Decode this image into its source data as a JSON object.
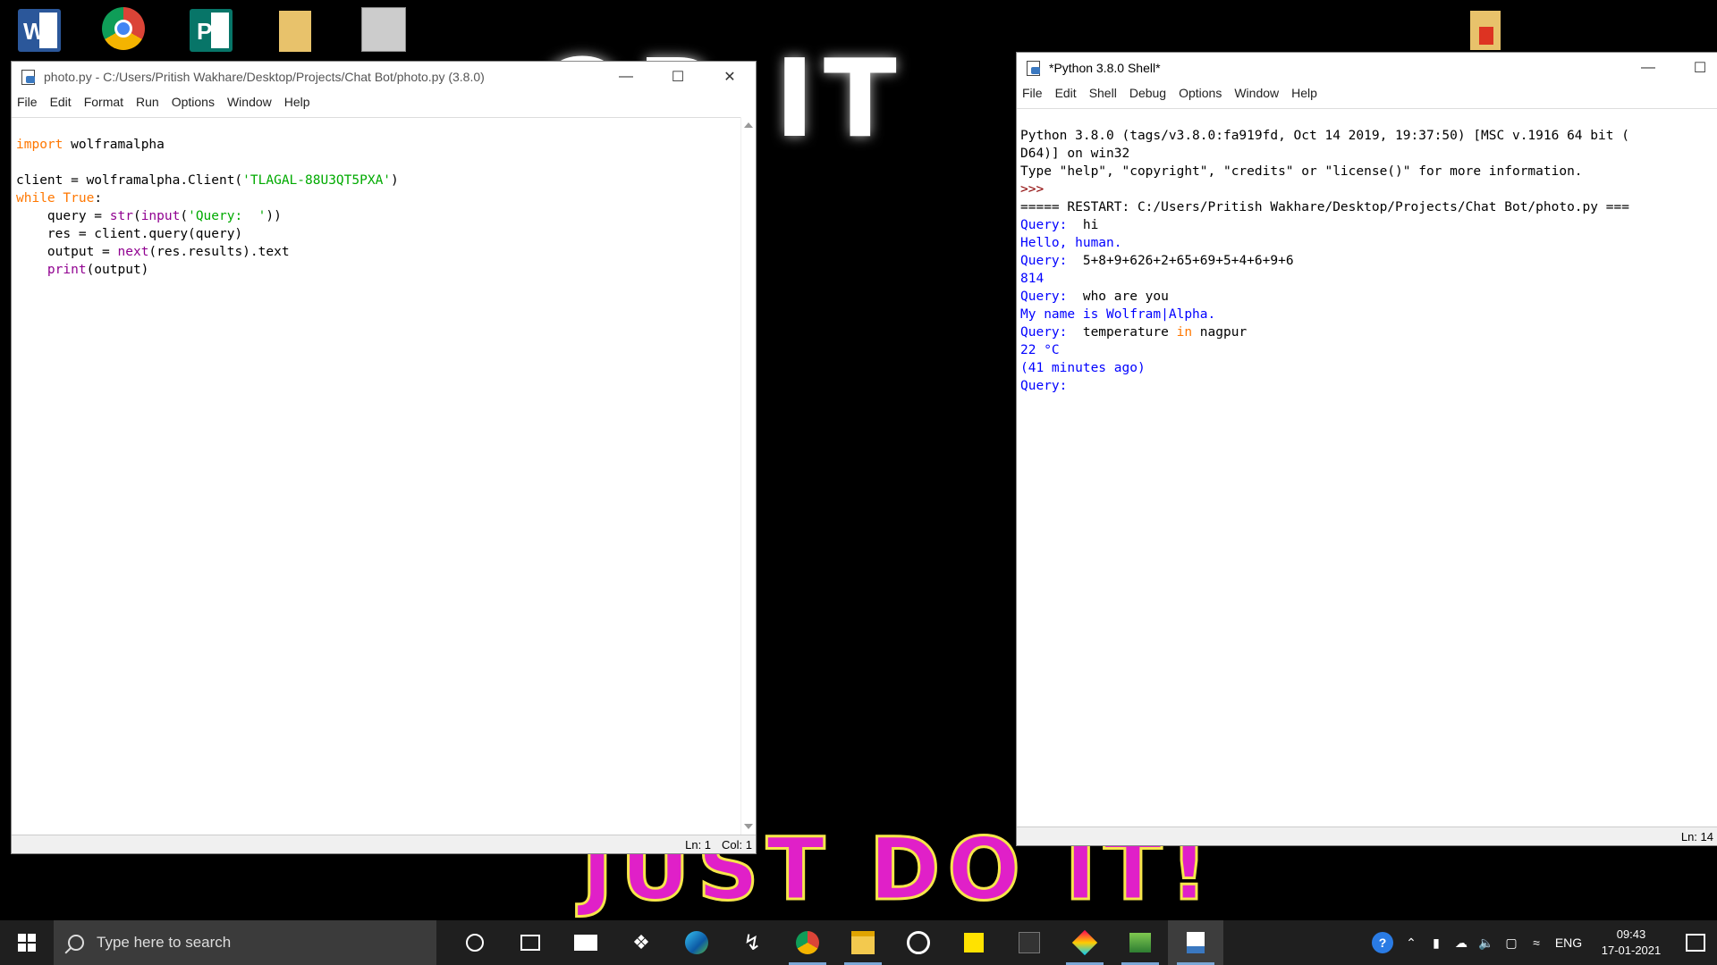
{
  "wallpaper": {
    "top_text": "OR IT",
    "bottom_text": "JUST DO IT!"
  },
  "desktop_icons": [
    "word-icon",
    "chrome-icon",
    "publisher-icon",
    "folder-icon",
    "image-file-icon",
    "pdf-folder-icon"
  ],
  "editor_window": {
    "title": "photo.py - C:/Users/Pritish Wakhare/Desktop/Projects/Chat Bot/photo.py (3.8.0)",
    "menu": [
      "File",
      "Edit",
      "Format",
      "Run",
      "Options",
      "Window",
      "Help"
    ],
    "code": {
      "l1_kw": "import",
      "l1_rest": " wolframalpha",
      "l3_a": "client = wolframalpha.Client(",
      "l3_str": "'TLAGAL-88U3QT5PXA'",
      "l3_b": ")",
      "l4_kw": "while",
      "l4_sp": " ",
      "l4_kw2": "True",
      "l4_b": ":",
      "l5_a": "    query = ",
      "l5_bi1": "str",
      "l5_p": "(",
      "l5_bi2": "input",
      "l5_p2": "(",
      "l5_str": "'Query:  '",
      "l5_b": "))",
      "l6": "    res = client.query(query)",
      "l7_a": "    output = ",
      "l7_bi": "next",
      "l7_b": "(res.results).text",
      "l8_a": "    ",
      "l8_bi": "print",
      "l8_b": "(output)"
    },
    "status": {
      "ln": "Ln: 1",
      "col": "Col: 1"
    }
  },
  "shell_window": {
    "title": "*Python 3.8.0 Shell*",
    "menu": [
      "File",
      "Edit",
      "Shell",
      "Debug",
      "Options",
      "Window",
      "Help"
    ],
    "lines": {
      "banner1": "Python 3.8.0 (tags/v3.8.0:fa919fd, Oct 14 2019, 19:37:50) [MSC v.1916 64 bit (",
      "banner2": "D64)] on win32",
      "banner3": "Type \"help\", \"copyright\", \"credits\" or \"license()\" for more information.",
      "prompt": ">>> ",
      "restart": "===== RESTART: C:/Users/Pritish Wakhare/Desktop/Projects/Chat Bot/photo.py ===",
      "q_label": "Query:  ",
      "q1": "hi",
      "a1": "Hello, human.",
      "q2": "5+8+9+626+2+65+69+5+4+6+9+6",
      "a2": "814",
      "q3": "who are you",
      "a3": "My name is Wolfram|Alpha.",
      "q4a": "temperature ",
      "q4kw": "in",
      "q4b": " nagpur",
      "a4a": "22 °C",
      "a4b": "(41 minutes ago)",
      "q5": "Query: "
    },
    "status": {
      "ln": "Ln: 14"
    }
  },
  "taskbar": {
    "search_placeholder": "Type here to search",
    "icons": [
      "cortana-icon",
      "task-view-icon",
      "mail-icon",
      "dropbox-icon",
      "edge-icon",
      "bolt-app-icon",
      "chrome-icon",
      "file-explorer-icon",
      "groove-music-icon",
      "sticky-notes-icon",
      "terminal-app-icon",
      "3d-viewer-icon",
      "image-editor-icon",
      "python-idle-icon"
    ],
    "language": "ENG",
    "time": "09:43",
    "date": "17-01-2021"
  }
}
